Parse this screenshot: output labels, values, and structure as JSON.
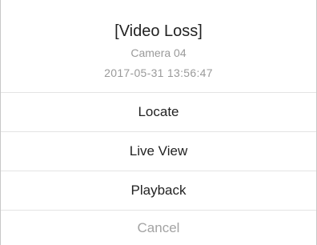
{
  "alert": {
    "title": "[Video Loss]",
    "camera": "Camera 04",
    "timestamp": "2017-05-31 13:56:47"
  },
  "actions": [
    {
      "label": "Locate"
    },
    {
      "label": "Live View"
    },
    {
      "label": "Playback"
    }
  ],
  "cancel_label": "Cancel",
  "colors": {
    "text_primary": "#222222",
    "text_secondary": "#9a9a9a",
    "divider": "#e4e4e4",
    "cancel": "#a3a3a3"
  }
}
